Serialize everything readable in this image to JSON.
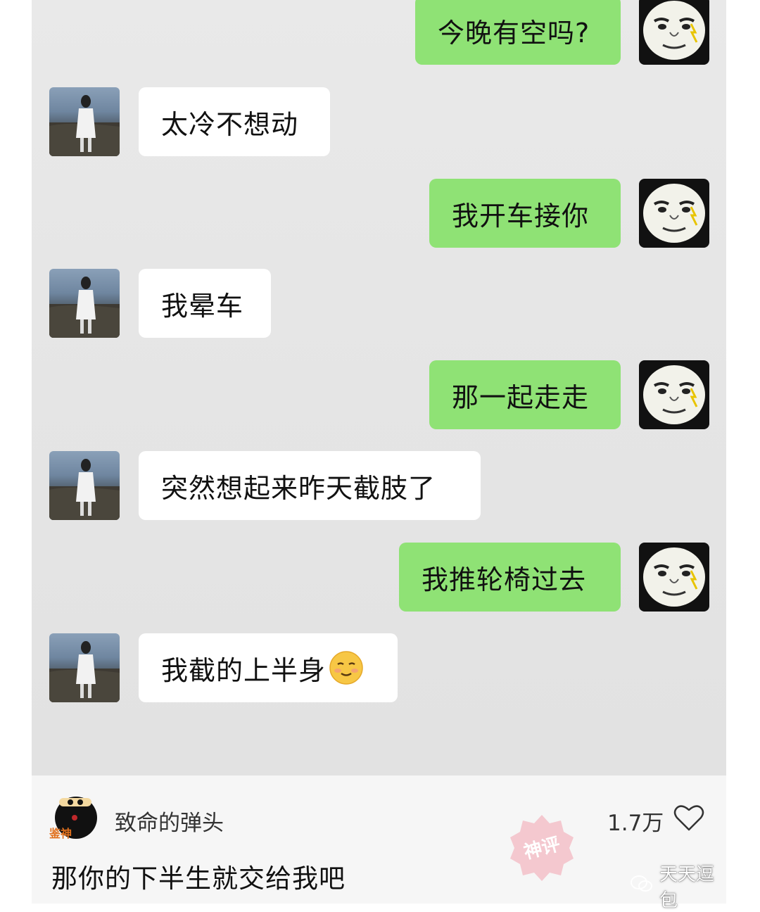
{
  "messages": [
    {
      "side": "right",
      "text": "今晚有空吗?"
    },
    {
      "side": "left",
      "text": "太冷不想动"
    },
    {
      "side": "right",
      "text": "我开车接你"
    },
    {
      "side": "left",
      "text": "我晕车"
    },
    {
      "side": "right",
      "text": "那一起走走"
    },
    {
      "side": "left",
      "text": "突然想起来昨天截肢了"
    },
    {
      "side": "right",
      "text": "我推轮椅过去"
    },
    {
      "side": "left",
      "text": "我截的上半身",
      "emoji": "slightly-smiling-face"
    }
  ],
  "comment": {
    "username": "致命的弹头",
    "likes": "1.7万",
    "text": "那你的下半生就交给我吧",
    "badge": "神评",
    "avatar_badge": "鉴神"
  },
  "watermark": {
    "text": "天天逗包"
  },
  "colors": {
    "sent_bubble": "#8fe275",
    "received_bubble": "#ffffff",
    "chat_background": "#e6e6e6"
  }
}
